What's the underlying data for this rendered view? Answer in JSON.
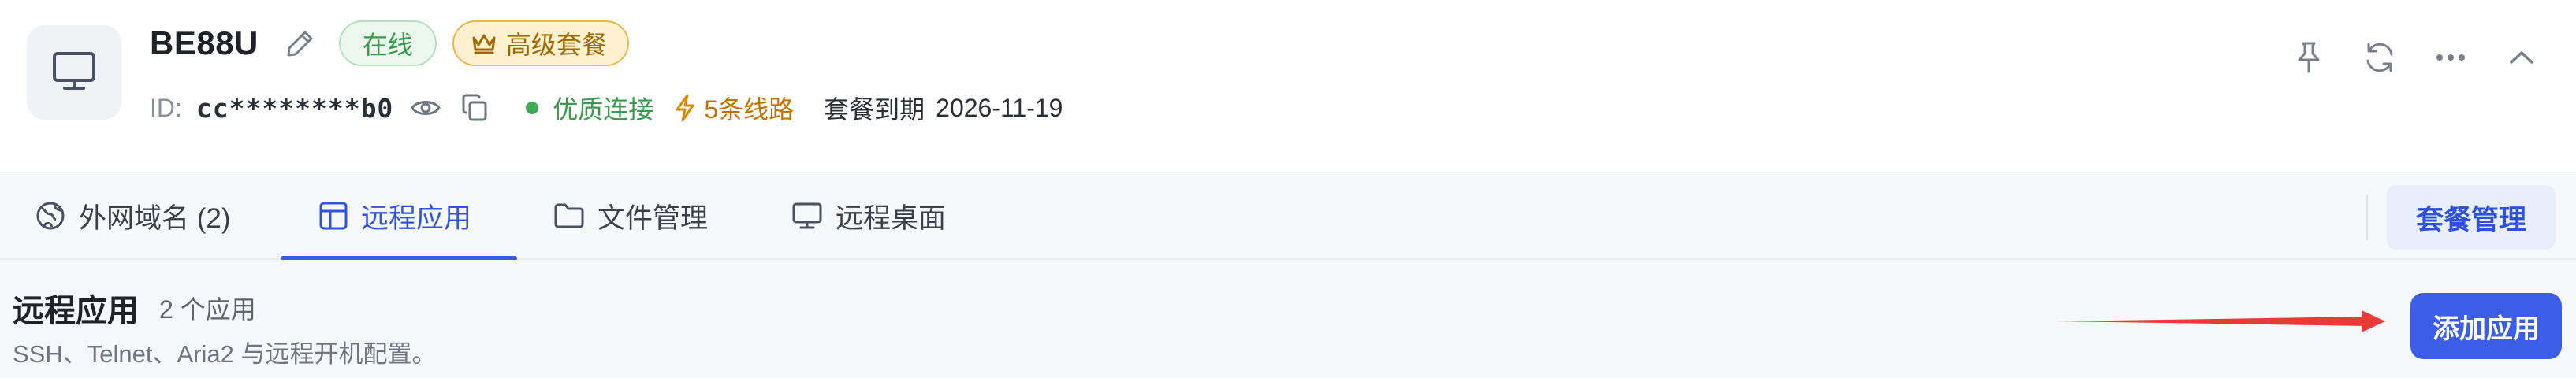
{
  "device": {
    "name": "BE88U",
    "status_badge": "在线",
    "plan_badge": "高级套餐",
    "id_label": "ID:",
    "id_value": "cc********b0",
    "connection_quality": "优质连接",
    "routes": "5条线路",
    "expiry_label": "套餐到期",
    "expiry_date": "2026-11-19"
  },
  "header_actions": [
    "pin-icon",
    "refresh-icon",
    "more-icon",
    "collapse-icon"
  ],
  "tabs": [
    {
      "label": "外网域名 (2)",
      "icon": "globe-icon",
      "active": false
    },
    {
      "label": "远程应用",
      "icon": "app-layout-icon",
      "active": true
    },
    {
      "label": "文件管理",
      "icon": "folder-icon",
      "active": false
    },
    {
      "label": "远程桌面",
      "icon": "monitor-icon",
      "active": false
    }
  ],
  "plan_management_label": "套餐管理",
  "section": {
    "title": "远程应用",
    "count": "2 个应用",
    "description": "SSH、Telnet、Aria2 与远程开机配置。",
    "add_button": "添加应用"
  },
  "colors": {
    "accent": "#3b5de7",
    "online_green": "#3b9a4f",
    "plan_gold": "#a06a00",
    "routes_orange": "#c27400",
    "annotation_arrow": "#e83a36"
  }
}
